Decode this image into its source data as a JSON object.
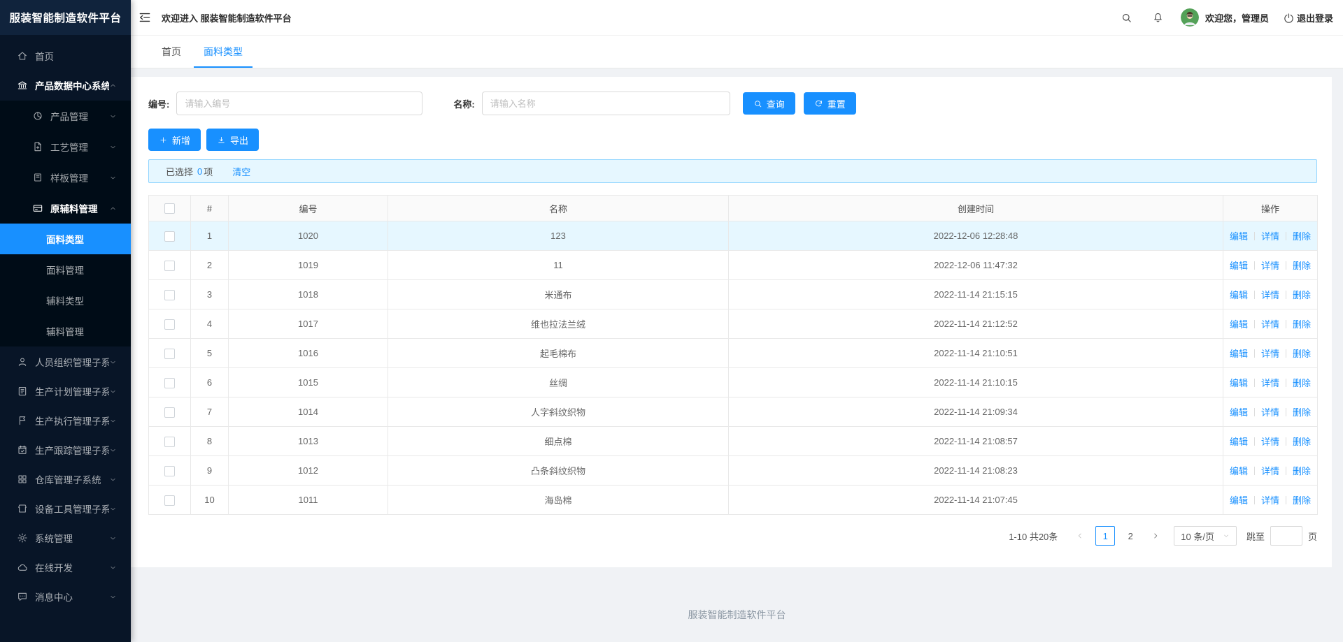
{
  "colors": {
    "accent": "#1890ff",
    "sidebar_bg": "#081527",
    "sidebar_dark": "#000c17",
    "logo_bg": "#10233c",
    "page_bg": "#f0f2f5",
    "alert_bg": "#e6f7ff",
    "alert_border": "#91d5ff",
    "row_highlight": "#e6f7ff",
    "avatar_green": "#54a158"
  },
  "sidebar": {
    "title": "服装智能制造软件平台",
    "items": [
      {
        "id": "home",
        "icon": "home-icon",
        "label": "首页",
        "level": 1
      },
      {
        "id": "product-data-center",
        "icon": "bank-icon",
        "label": "产品数据中心系统",
        "level": 1,
        "chevron": "up",
        "open": true
      },
      {
        "id": "product-mgmt",
        "icon": "pie-chart-icon",
        "label": "产品管理",
        "level": 2,
        "chevron": "down",
        "dark": true
      },
      {
        "id": "process-mgmt",
        "icon": "file-add-icon",
        "label": "工艺管理",
        "level": 2,
        "chevron": "down",
        "dark": true
      },
      {
        "id": "sample-mgmt",
        "icon": "clipboard-icon",
        "label": "样板管理",
        "level": 2,
        "chevron": "down",
        "dark": true
      },
      {
        "id": "raw-material-mgmt",
        "icon": "credit-card-icon",
        "label": "原辅料管理",
        "level": 2,
        "chevron": "up",
        "dark": true,
        "open": true
      },
      {
        "id": "fabric-type",
        "label": "面料类型",
        "level": 3,
        "dark": true,
        "active": true
      },
      {
        "id": "fabric-mgmt",
        "label": "面料管理",
        "level": 3,
        "dark": true
      },
      {
        "id": "accessory-type",
        "label": "辅料类型",
        "level": 3,
        "dark": true
      },
      {
        "id": "accessory-mgmt",
        "label": "辅料管理",
        "level": 3,
        "dark": true
      },
      {
        "id": "personnel-org",
        "icon": "user-icon",
        "label": "人员组织管理子系统",
        "level": 1,
        "chevron": "down"
      },
      {
        "id": "production-plan",
        "icon": "profile-icon",
        "label": "生产计划管理子系统",
        "level": 1,
        "chevron": "down"
      },
      {
        "id": "production-exec",
        "icon": "flag-icon",
        "label": "生产执行管理子系统",
        "level": 1,
        "chevron": "down"
      },
      {
        "id": "production-track",
        "icon": "audit-icon",
        "label": "生产跟踪管理子系统",
        "level": 1,
        "chevron": "down"
      },
      {
        "id": "warehouse",
        "icon": "appstore-icon",
        "label": "仓库管理子系统",
        "level": 1,
        "chevron": "down"
      },
      {
        "id": "equipment-tool",
        "icon": "shop-icon",
        "label": "设备工具管理子系统",
        "level": 1,
        "chevron": "down"
      },
      {
        "id": "system-mgmt",
        "icon": "gear-icon",
        "label": "系统管理",
        "level": 1,
        "chevron": "down"
      },
      {
        "id": "online-dev",
        "icon": "cloud-icon",
        "label": "在线开发",
        "level": 1,
        "chevron": "down"
      },
      {
        "id": "message-center",
        "icon": "message-icon",
        "label": "消息中心",
        "level": 1,
        "chevron": "down"
      }
    ]
  },
  "header": {
    "welcome": "欢迎进入 服装智能制造软件平台",
    "greeting": "欢迎您，管理员",
    "logout_label": "退出登录",
    "icons": [
      "menu-fold-icon",
      "search-icon",
      "bell-icon",
      "avatar",
      "logout-icon"
    ]
  },
  "tabs": [
    {
      "label": "首页",
      "active": false
    },
    {
      "label": "面料类型",
      "active": true
    }
  ],
  "filters": {
    "code_label": "编号:",
    "code_placeholder": "请输入编号",
    "code_value": "",
    "name_label": "名称:",
    "name_placeholder": "请输入名称",
    "name_value": "",
    "search_label": "查询",
    "reset_label": "重置"
  },
  "toolbar": {
    "add_label": "新增",
    "export_label": "导出"
  },
  "selection": {
    "prefix": "已选择",
    "count": "0",
    "suffix": "项",
    "clear_label": "清空"
  },
  "table": {
    "headers": [
      "#",
      "编号",
      "名称",
      "创建时间",
      "操作"
    ],
    "actions": [
      {
        "label": "编辑",
        "name": "edit-link"
      },
      {
        "label": "详情",
        "name": "detail-link"
      },
      {
        "label": "删除",
        "name": "delete-link"
      }
    ],
    "rows": [
      {
        "index": "1",
        "code": "1020",
        "name": "123",
        "created": "2022-12-06 12:28:48"
      },
      {
        "index": "2",
        "code": "1019",
        "name": "11",
        "created": "2022-12-06 11:47:32"
      },
      {
        "index": "3",
        "code": "1018",
        "name": "米通布",
        "created": "2022-11-14 21:15:15"
      },
      {
        "index": "4",
        "code": "1017",
        "name": "维也拉法兰绒",
        "created": "2022-11-14 21:12:52"
      },
      {
        "index": "5",
        "code": "1016",
        "name": "起毛棉布",
        "created": "2022-11-14 21:10:51"
      },
      {
        "index": "6",
        "code": "1015",
        "name": "丝绸",
        "created": "2022-11-14 21:10:15"
      },
      {
        "index": "7",
        "code": "1014",
        "name": "人字斜纹织物",
        "created": "2022-11-14 21:09:34"
      },
      {
        "index": "8",
        "code": "1013",
        "name": "细点棉",
        "created": "2022-11-14 21:08:57"
      },
      {
        "index": "9",
        "code": "1012",
        "name": "凸条斜纹织物",
        "created": "2022-11-14 21:08:23"
      },
      {
        "index": "10",
        "code": "1011",
        "name": "海岛棉",
        "created": "2022-11-14 21:07:45"
      }
    ]
  },
  "pagination": {
    "summary": "1-10 共20条",
    "pages": [
      "1",
      "2"
    ],
    "active_page": "1",
    "page_size": "10 条/页",
    "jump_label": "跳至",
    "page_unit": "页",
    "jump_value": ""
  },
  "footer": {
    "text": "服装智能制造软件平台"
  }
}
